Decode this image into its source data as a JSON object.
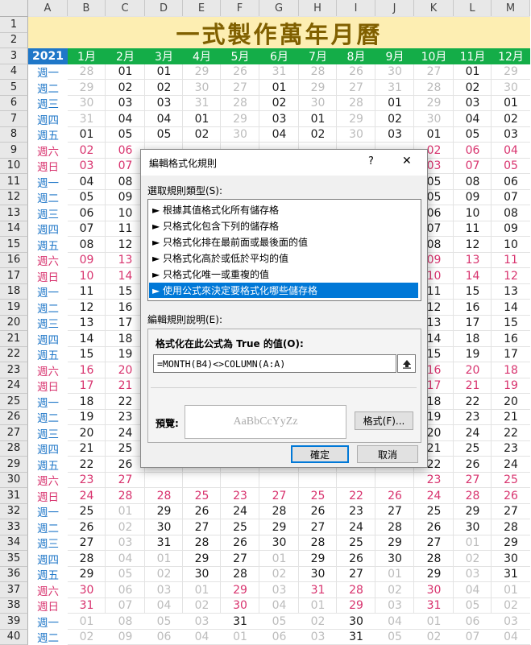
{
  "columns": [
    "A",
    "B",
    "C",
    "D",
    "E",
    "F",
    "G",
    "H",
    "I",
    "J",
    "K",
    "L",
    "M"
  ],
  "rows": [
    "1",
    "2",
    "3",
    "4",
    "5",
    "6",
    "7",
    "8",
    "9",
    "10",
    "11",
    "12",
    "13",
    "14",
    "15",
    "16",
    "17",
    "18",
    "19",
    "20",
    "21",
    "22",
    "23",
    "24",
    "25",
    "26",
    "27",
    "28",
    "29",
    "30",
    "31",
    "32",
    "33",
    "34",
    "35",
    "36",
    "37",
    "38",
    "39",
    "40"
  ],
  "title": "一式製作萬年月曆",
  "year": "2021",
  "months": [
    "1月",
    "2月",
    "3月",
    "4月",
    "5月",
    "6月",
    "7月",
    "8月",
    "9月",
    "10月",
    "11月",
    "12月"
  ],
  "weekdays_col": [
    "週一",
    "週二",
    "週三",
    "週四",
    "週五",
    "週六",
    "週日",
    "週一",
    "週二",
    "週三",
    "週四",
    "週五",
    "週六",
    "週日",
    "週一",
    "週二",
    "週三",
    "週四",
    "週五",
    "週六",
    "週日",
    "週一",
    "週二",
    "週三",
    "週四",
    "週五",
    "週六",
    "週日",
    "週一",
    "週二",
    "週三",
    "週四",
    "週五",
    "週六",
    "週日",
    "週一",
    "週二"
  ],
  "grid": [
    [
      "28",
      "01",
      "01",
      "29",
      "26",
      "31",
      "28",
      "26",
      "30",
      "27",
      "01",
      "29"
    ],
    [
      "29",
      "02",
      "02",
      "30",
      "27",
      "01",
      "29",
      "27",
      "31",
      "28",
      "02",
      "30"
    ],
    [
      "30",
      "03",
      "03",
      "31",
      "28",
      "02",
      "30",
      "28",
      "01",
      "29",
      "03",
      "01"
    ],
    [
      "31",
      "04",
      "04",
      "01",
      "29",
      "03",
      "01",
      "29",
      "02",
      "30",
      "04",
      "02"
    ],
    [
      "01",
      "05",
      "05",
      "02",
      "30",
      "04",
      "02",
      "30",
      "03",
      "01",
      "05",
      "03"
    ],
    [
      "02",
      "06",
      "",
      "",
      "",
      "",
      "",
      "",
      "",
      "02",
      "06",
      "04"
    ],
    [
      "03",
      "07",
      "",
      "",
      "",
      "",
      "",
      "",
      "",
      "03",
      "07",
      "05"
    ],
    [
      "04",
      "08",
      "",
      "",
      "",
      "",
      "",
      "",
      "",
      "05",
      "08",
      "06"
    ],
    [
      "05",
      "09",
      "",
      "",
      "",
      "",
      "",
      "",
      "",
      "05",
      "09",
      "07"
    ],
    [
      "06",
      "10",
      "",
      "",
      "",
      "",
      "",
      "",
      "",
      "06",
      "10",
      "08"
    ],
    [
      "07",
      "11",
      "",
      "",
      "",
      "",
      "",
      "",
      "",
      "07",
      "11",
      "09"
    ],
    [
      "08",
      "12",
      "",
      "",
      "",
      "",
      "",
      "",
      "",
      "08",
      "12",
      "10"
    ],
    [
      "09",
      "13",
      "",
      "",
      "",
      "",
      "",
      "",
      "",
      "09",
      "13",
      "11"
    ],
    [
      "10",
      "14",
      "",
      "",
      "",
      "",
      "",
      "",
      "",
      "10",
      "14",
      "12"
    ],
    [
      "11",
      "15",
      "",
      "",
      "",
      "",
      "",
      "",
      "",
      "11",
      "15",
      "13"
    ],
    [
      "12",
      "16",
      "",
      "",
      "",
      "",
      "",
      "",
      "",
      "12",
      "16",
      "14"
    ],
    [
      "13",
      "17",
      "",
      "",
      "",
      "",
      "",
      "",
      "",
      "13",
      "17",
      "15"
    ],
    [
      "14",
      "18",
      "",
      "",
      "",
      "",
      "",
      "",
      "",
      "14",
      "18",
      "16"
    ],
    [
      "15",
      "19",
      "",
      "",
      "",
      "",
      "",
      "",
      "",
      "15",
      "19",
      "17"
    ],
    [
      "16",
      "20",
      "",
      "",
      "",
      "",
      "",
      "",
      "",
      "16",
      "20",
      "18"
    ],
    [
      "17",
      "21",
      "",
      "",
      "",
      "",
      "",
      "",
      "",
      "17",
      "21",
      "19"
    ],
    [
      "18",
      "22",
      "",
      "",
      "",
      "",
      "",
      "",
      "",
      "18",
      "22",
      "20"
    ],
    [
      "19",
      "23",
      "",
      "",
      "",
      "",
      "",
      "",
      "",
      "19",
      "23",
      "21"
    ],
    [
      "20",
      "24",
      "",
      "",
      "",
      "",
      "",
      "",
      "",
      "20",
      "24",
      "22"
    ],
    [
      "21",
      "25",
      "",
      "",
      "",
      "",
      "",
      "",
      "",
      "21",
      "25",
      "23"
    ],
    [
      "22",
      "26",
      "",
      "",
      "",
      "",
      "",
      "",
      "",
      "22",
      "26",
      "24"
    ],
    [
      "23",
      "27",
      "",
      "",
      "",
      "",
      "",
      "",
      "",
      "23",
      "27",
      "25"
    ],
    [
      "24",
      "28",
      "28",
      "25",
      "23",
      "27",
      "25",
      "22",
      "26",
      "24",
      "28",
      "26"
    ],
    [
      "25",
      "01",
      "29",
      "26",
      "24",
      "28",
      "26",
      "23",
      "27",
      "25",
      "29",
      "27"
    ],
    [
      "26",
      "02",
      "30",
      "27",
      "25",
      "29",
      "27",
      "24",
      "28",
      "26",
      "30",
      "28"
    ],
    [
      "27",
      "03",
      "31",
      "28",
      "26",
      "30",
      "28",
      "25",
      "29",
      "27",
      "01",
      "29"
    ],
    [
      "28",
      "04",
      "01",
      "29",
      "27",
      "01",
      "29",
      "26",
      "30",
      "28",
      "02",
      "30"
    ],
    [
      "29",
      "05",
      "02",
      "30",
      "28",
      "02",
      "30",
      "27",
      "01",
      "29",
      "03",
      "31"
    ],
    [
      "30",
      "06",
      "03",
      "01",
      "29",
      "03",
      "31",
      "28",
      "02",
      "30",
      "04",
      "01"
    ],
    [
      "31",
      "07",
      "04",
      "02",
      "30",
      "04",
      "01",
      "29",
      "03",
      "31",
      "05",
      "02"
    ],
    [
      "01",
      "08",
      "05",
      "03",
      "31",
      "05",
      "02",
      "30",
      "04",
      "01",
      "06",
      "03"
    ],
    [
      "02",
      "09",
      "06",
      "04",
      "01",
      "06",
      "03",
      "31",
      "05",
      "02",
      "07",
      "04"
    ]
  ],
  "colors": {
    "in_month": "#1a1a1a",
    "out_month": "#bcbcbc",
    "weekend": "#d8336e",
    "weekday_label": "#1f77c8",
    "title_bg": "#fdeeb2",
    "title_fg": "#806000",
    "year_bg": "#1f77c8",
    "month_bg": "#14ad48",
    "selected": "#0078d7"
  },
  "dialog": {
    "title": "編輯格式化規則",
    "help_label": "?",
    "close_label": "✕",
    "rule_type_label": "選取規則類型(S):",
    "rule_types": [
      "► 根據其值格式化所有儲存格",
      "► 只格式化包含下列的儲存格",
      "► 只格式化排在最前面或最後面的值",
      "► 只格式化高於或低於平均的值",
      "► 只格式化唯一或重複的值",
      "► 使用公式來決定要格式化哪些儲存格"
    ],
    "selected_rule_index": 5,
    "rule_desc_label": "編輯規則說明(E):",
    "formula_label": "格式化在此公式為 True 的值(O):",
    "formula_value": "=MONTH(B4)<>COLUMN(A:A)",
    "range_icon": "collapse-range-icon",
    "preview_label": "預覽:",
    "preview_text": "AaBbCcYyZz",
    "format_button": "格式(F)...",
    "ok_button": "確定",
    "cancel_button": "取消"
  }
}
